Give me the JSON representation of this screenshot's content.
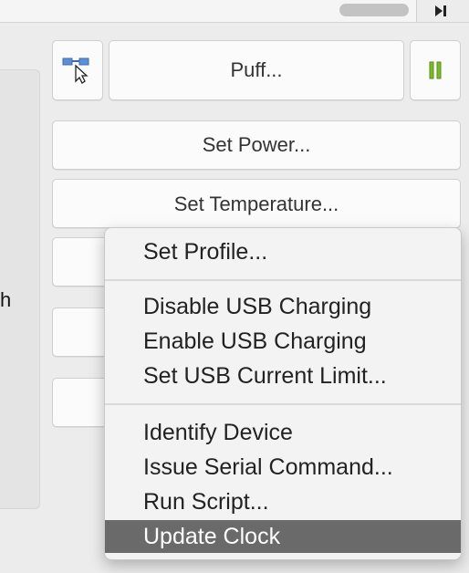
{
  "toolbar": {
    "puff_label": "Puff...",
    "pause_color": "#7dba2a"
  },
  "buttons": {
    "set_power": "Set Power...",
    "set_temperature": "Set Temperature..."
  },
  "left_panel": {
    "truncated_text": "h"
  },
  "menu": {
    "items": [
      {
        "label": "Set Profile..."
      },
      {
        "label": "Disable USB Charging"
      },
      {
        "label": "Enable USB Charging"
      },
      {
        "label": "Set USB Current Limit..."
      },
      {
        "label": "Identify Device"
      },
      {
        "label": "Issue Serial Command..."
      },
      {
        "label": "Run Script..."
      },
      {
        "label": "Update Clock",
        "highlighted": true
      }
    ],
    "highlight_color": "#6a6a6a"
  },
  "icons": {
    "connect": "network-cursor-icon",
    "pause": "pause-icon",
    "step": "step-forward-icon"
  }
}
